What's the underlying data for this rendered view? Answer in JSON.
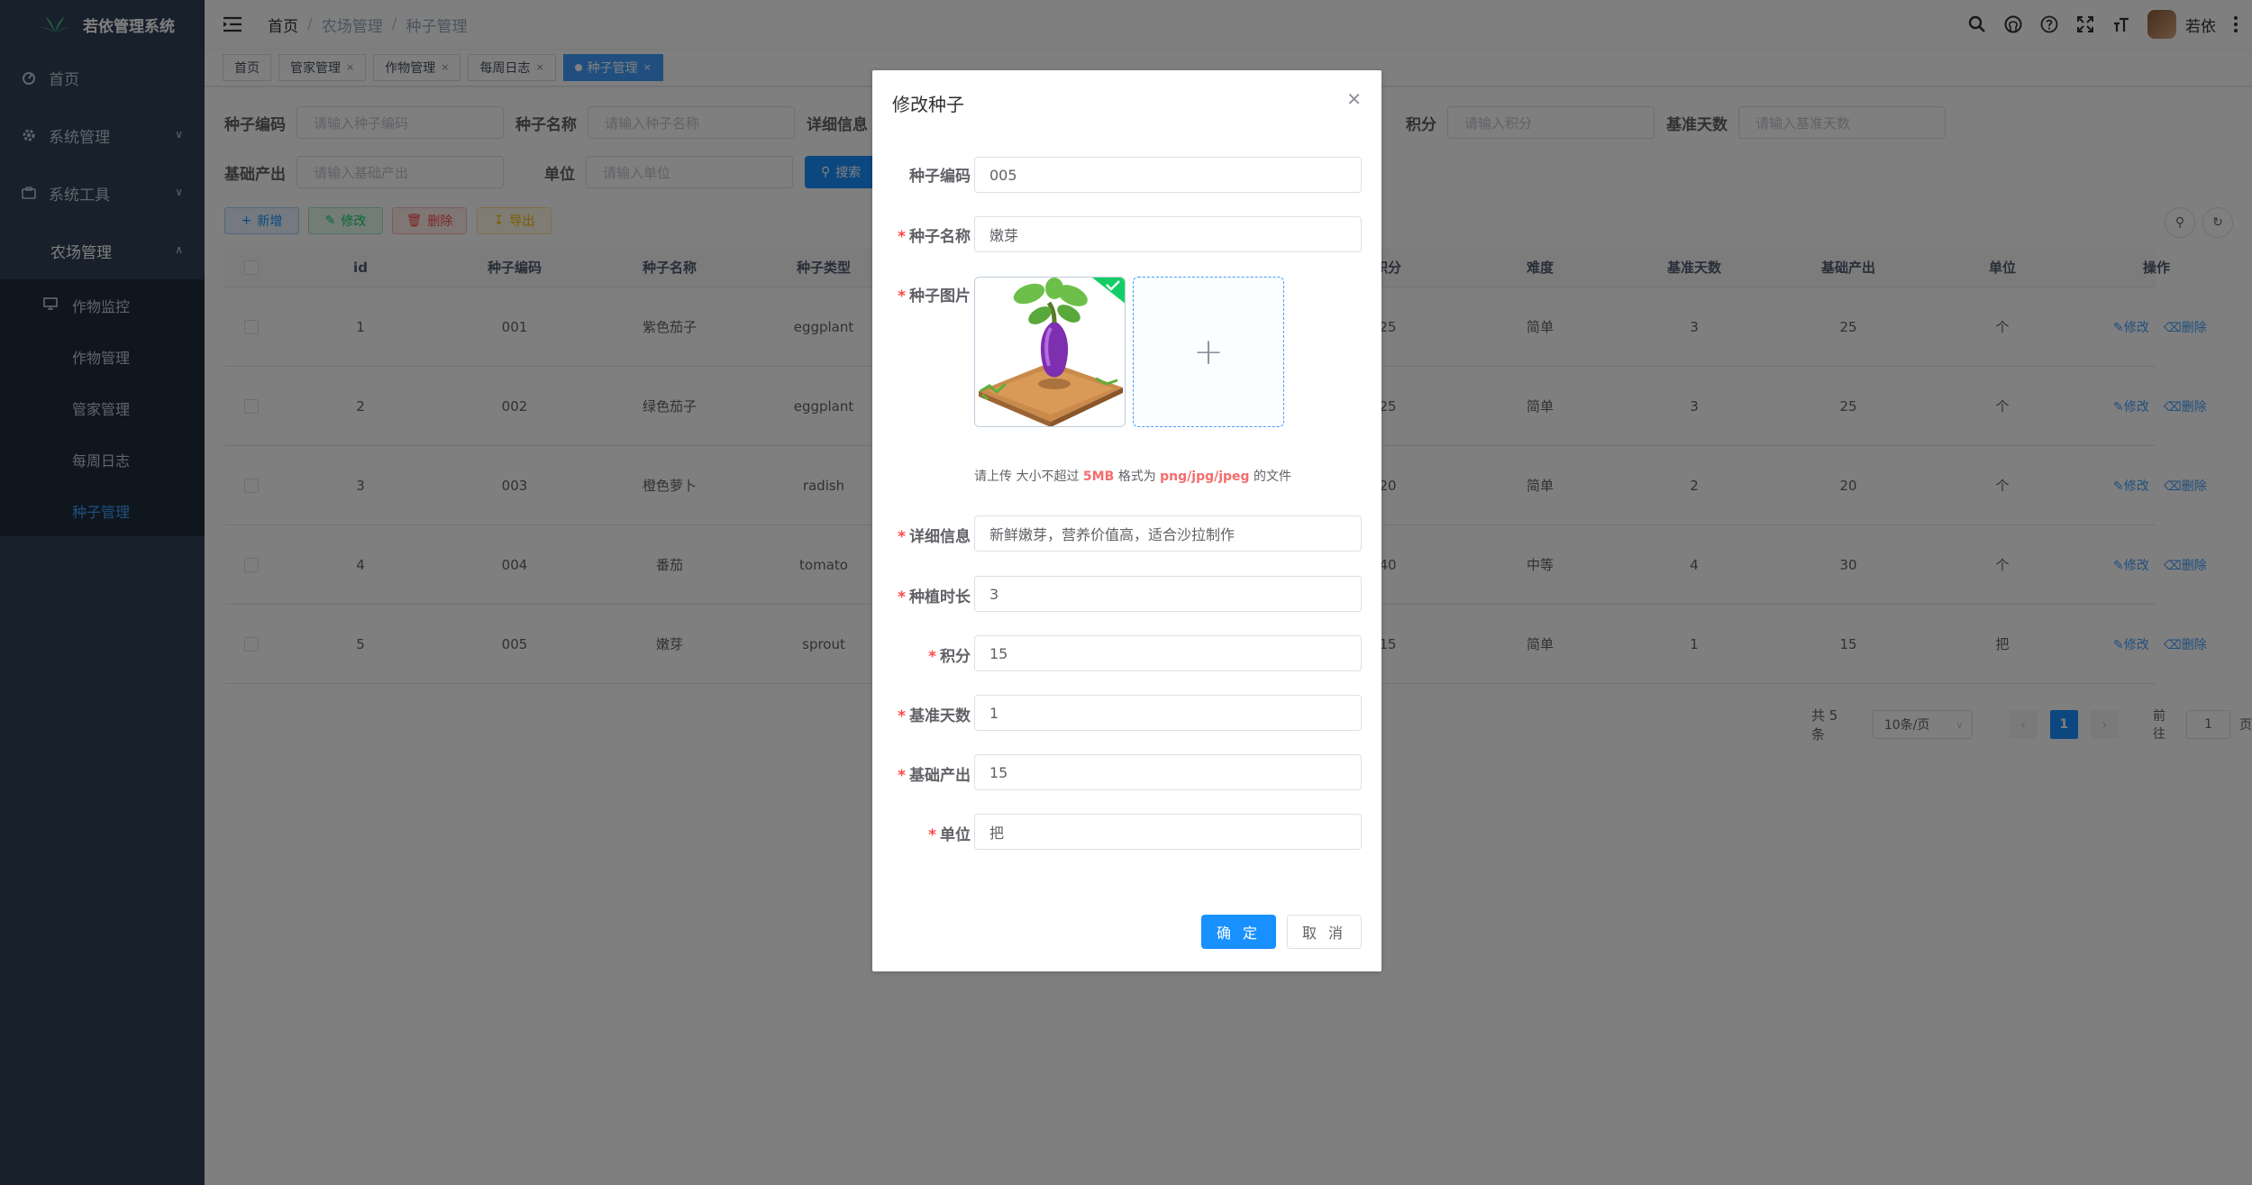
{
  "app": {
    "title": "若依管理系统"
  },
  "sidebar": {
    "items": [
      {
        "label": "首页",
        "icon": "dashboard-icon"
      },
      {
        "label": "系统管理",
        "icon": "gear-icon"
      },
      {
        "label": "系统工具",
        "icon": "toolbox-icon"
      },
      {
        "label": "农场管理",
        "icon": ""
      }
    ],
    "farm_sub": [
      {
        "label": "作物监控",
        "icon": "monitor-icon"
      },
      {
        "label": "作物管理"
      },
      {
        "label": "管家管理"
      },
      {
        "label": "每周日志"
      },
      {
        "label": "种子管理"
      }
    ]
  },
  "navbar": {
    "breadcrumb": [
      "首页",
      "/",
      "农场管理",
      "/",
      "种子管理"
    ],
    "username": "若依"
  },
  "tags": [
    "首页",
    "管家管理",
    "作物管理",
    "每周日志",
    "种子管理"
  ],
  "search": {
    "seed_code_label": "种子编码",
    "seed_code_ph": "请输入种子编码",
    "seed_name_label": "种子名称",
    "seed_name_ph": "请输入种子名称",
    "detail_label": "详细信息",
    "points_label": "积分",
    "points_ph": "请输入积分",
    "base_days_label": "基准天数",
    "base_days_ph": "请输入基准天数",
    "base_output_label": "基础产出",
    "base_output_ph": "请输入基础产出",
    "unit_label": "单位",
    "unit_ph": "请输入单位",
    "search_btn": "搜索"
  },
  "toolbar": {
    "add": "新增",
    "edit": "修改",
    "delete": "删除",
    "export": "导出"
  },
  "table": {
    "headers": [
      "id",
      "种子编码",
      "种子名称",
      "种子类型",
      "积分",
      "难度",
      "基准天数",
      "基础产出",
      "单位",
      "操作"
    ],
    "rows": [
      {
        "id": "1",
        "code": "001",
        "name": "紫色茄子",
        "type": "eggplant",
        "points": "25",
        "difficulty": "简单",
        "days": "3",
        "output": "25",
        "unit": "个"
      },
      {
        "id": "2",
        "code": "002",
        "name": "绿色茄子",
        "type": "eggplant",
        "points": "25",
        "difficulty": "简单",
        "days": "3",
        "output": "25",
        "unit": "个"
      },
      {
        "id": "3",
        "code": "003",
        "name": "橙色萝卜",
        "type": "radish",
        "points": "20",
        "difficulty": "简单",
        "days": "2",
        "output": "20",
        "unit": "个"
      },
      {
        "id": "4",
        "code": "004",
        "name": "番茄",
        "type": "tomato",
        "points": "40",
        "difficulty": "中等",
        "days": "4",
        "output": "30",
        "unit": "个"
      },
      {
        "id": "5",
        "code": "005",
        "name": "嫩芽",
        "type": "sprout",
        "points": "15",
        "difficulty": "简单",
        "days": "1",
        "output": "15",
        "unit": "把"
      }
    ],
    "op_edit": "修改",
    "op_delete": "删除"
  },
  "pager": {
    "total": "共 5 条",
    "size": "10条/页",
    "page": "1",
    "goto": "前往",
    "goto_val": "1",
    "page_suffix": "页"
  },
  "dialog": {
    "title": "修改种子",
    "labels": {
      "code": "种子编码",
      "name": "种子名称",
      "image": "种子图片",
      "detail": "详细信息",
      "duration": "种植时长",
      "points": "积分",
      "base_days": "基准天数",
      "base_output": "基础产出",
      "unit": "单位"
    },
    "values": {
      "code": "005",
      "name": "嫩芽",
      "detail": "新鲜嫩芽，营养价值高，适合沙拉制作",
      "duration": "3",
      "points": "15",
      "base_days": "1",
      "base_output": "15",
      "unit": "把"
    },
    "tip_prefix": "请上传 大小不超过 ",
    "tip_size": "5MB",
    "tip_mid": " 格式为 ",
    "tip_formats": "png/jpg/jpeg",
    "tip_suffix": " 的文件",
    "ok": "确 定",
    "cancel": "取 消"
  },
  "colors": {
    "sidebar": "#304156",
    "submenu": "#1f2d3d",
    "primary": "#1890ff",
    "active_text": "#409eff"
  }
}
